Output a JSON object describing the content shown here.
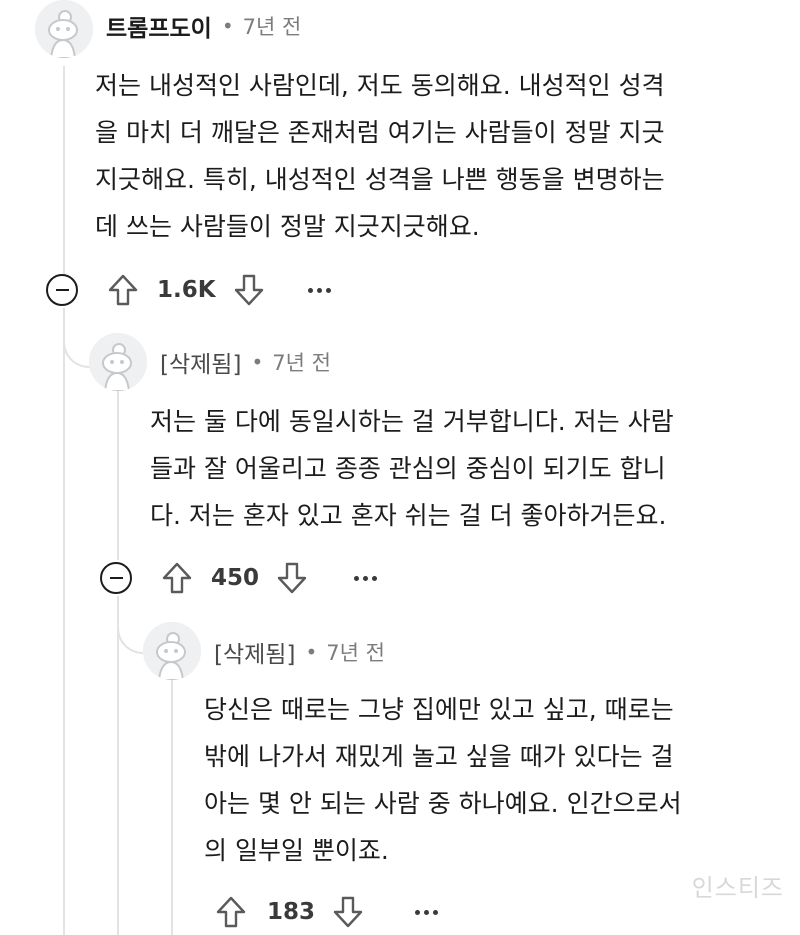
{
  "comments": [
    {
      "author": "트롬프도이",
      "separator": "•",
      "time": "7년 전",
      "body": "저는 내성적인 사람인데, 저도 동의해요. 내성적인 성격\n을 마치 더 깨달은 존재처럼 여기는 사람들이 정말 지긋\n지긋해요. 특히, 내성적인 성격을 나쁜 행동을 변명하는\n데 쓰는 사람들이 정말 지긋지긋해요.",
      "score": "1.6K"
    },
    {
      "author": "[삭제됨]",
      "separator": "•",
      "time": "7년 전",
      "body": "저는 둘 다에 동일시하는 걸 거부합니다. 저는 사람\n들과 잘 어울리고 종종 관심의 중심이 되기도 합니\n다. 저는 혼자 있고 혼자 쉬는 걸 더 좋아하거든요.",
      "score": "450"
    },
    {
      "author": "[삭제됨]",
      "separator": "•",
      "time": "7년 전",
      "body": "당신은 때로는 그냥 집에만 있고 싶고, 때로는\n밖에 나가서 재밌게 놀고 싶을 때가 있다는 걸\n아는 몇 안 되는 사람 중 하나예요. 인간으로서\n의 일부일 뿐이죠.",
      "score": "183"
    }
  ],
  "icons": {
    "avatar": "reddit-snoo-avatar-icon",
    "collapse": "collapse-minus-icon",
    "upvote": "upvote-arrow-icon",
    "downvote": "downvote-arrow-icon",
    "more": "more-options-icon"
  },
  "watermark": "인스티즈",
  "colors": {
    "thread_line": "#e3e3e3",
    "text": "#1c1c1c",
    "muted": "#7c7c7c"
  }
}
